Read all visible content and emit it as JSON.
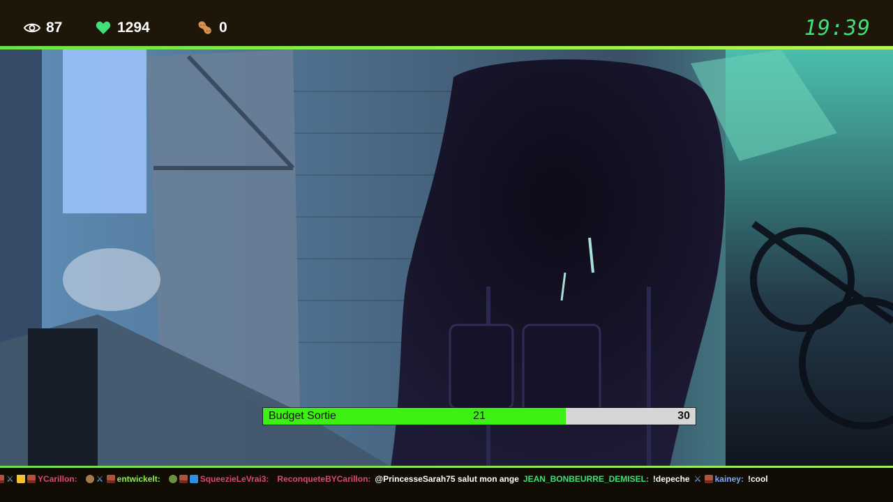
{
  "header": {
    "viewers": "87",
    "likes": "1294",
    "peanuts": "0",
    "clock": "19:39",
    "accent_color": "#3fe07a"
  },
  "budget": {
    "label": "Budget Sortie",
    "current": "21",
    "goal": "30",
    "progress_fraction": 0.7,
    "fill_color": "#3df014"
  },
  "chat": [
    {
      "user": "YCarillon:",
      "color": "#e0457a",
      "badges": [
        "brick",
        "sword",
        "crown",
        "brick"
      ],
      "text": ""
    },
    {
      "user": "entwickelt:",
      "color": "#8ff04a",
      "badges": [
        "face",
        "sword",
        "brick"
      ],
      "text": ""
    },
    {
      "user": "SqueezieLeVrai3:",
      "color": "#e0457a",
      "badges": [
        "frog",
        "brick",
        "cube"
      ],
      "text": ""
    },
    {
      "user": "ReconqueteBYCarillon:",
      "color": "#e0457a",
      "badges": [],
      "text": "@PrincesseSarah75 salut mon ange"
    },
    {
      "user": "JEAN_BONBEURRE_DEMISEL:",
      "color": "#3fe07a",
      "badges": [],
      "text": "!depeche"
    },
    {
      "user": "kainey:",
      "color": "#7fa7ff",
      "badges": [
        "sword",
        "brick"
      ],
      "text": "!cool"
    }
  ]
}
